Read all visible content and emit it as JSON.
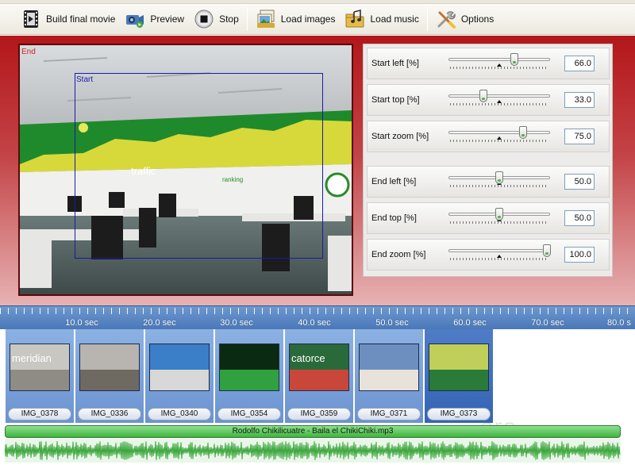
{
  "toolbar": {
    "buttons": [
      {
        "label": "Build final movie",
        "icon": "film-icon"
      },
      {
        "label": "Preview",
        "icon": "camcorder-icon"
      },
      {
        "label": "Stop",
        "icon": "stop-icon"
      },
      {
        "label": "Load images",
        "icon": "images-icon"
      },
      {
        "label": "Load music",
        "icon": "music-folder-icon"
      },
      {
        "label": "Options",
        "icon": "tools-icon"
      }
    ]
  },
  "preview": {
    "end_label": "End",
    "start_label": "Start",
    "end_color": "#cc2222",
    "start_color": "#1a1aaa"
  },
  "sliders": [
    {
      "label": "Start left [%]",
      "value": "66.0",
      "level": 0.66
    },
    {
      "label": "Start top [%]",
      "value": "33.0",
      "level": 0.33
    },
    {
      "label": "Start zoom [%]",
      "value": "75.0",
      "level": 0.75
    },
    {
      "label": "End left [%]",
      "value": "50.0",
      "level": 0.5
    },
    {
      "label": "End top [%]",
      "value": "50.0",
      "level": 0.5
    },
    {
      "label": "End zoom [%]",
      "value": "100.0",
      "level": 1.0
    }
  ],
  "timeline": {
    "ruler_labels": [
      "10.0 sec",
      "20.0 sec",
      "30.0 sec",
      "40.0 sec",
      "50.0 sec",
      "60.0 sec",
      "70.0 sec",
      "80.0 s"
    ],
    "clips": [
      {
        "name": "IMG_0378",
        "thumb_text": "meridian",
        "colors": [
          "#c9c7c2",
          "#8f8c86"
        ]
      },
      {
        "name": "IMG_0336",
        "thumb_text": "",
        "colors": [
          "#b8b4b0",
          "#6e6a62"
        ]
      },
      {
        "name": "IMG_0340",
        "thumb_text": "",
        "colors": [
          "#3a7fc8",
          "#d8d8d8"
        ]
      },
      {
        "name": "IMG_0354",
        "thumb_text": "",
        "colors": [
          "#0b2a12",
          "#30a040"
        ]
      },
      {
        "name": "IMG_0359",
        "thumb_text": "catorce",
        "colors": [
          "#2a6a3a",
          "#c9473a"
        ]
      },
      {
        "name": "IMG_0371",
        "thumb_text": "",
        "colors": [
          "#6c8fc0",
          "#e7e2da"
        ]
      },
      {
        "name": "IMG_0373",
        "thumb_text": "",
        "colors": [
          "#bfcf5a",
          "#2a7a3a"
        ]
      }
    ],
    "selected_clip": "IMG_0373",
    "watermark": "ere",
    "audio_track": "Rodolfo Chikilicuatre - Baila el ChikiChiki.mp3"
  },
  "colors": {
    "editor_bg": "#c12f32",
    "ruler": "#5a86c2",
    "clip": "#7ca2da",
    "clip_selected": "#4573bf",
    "audio": "#53c153"
  }
}
